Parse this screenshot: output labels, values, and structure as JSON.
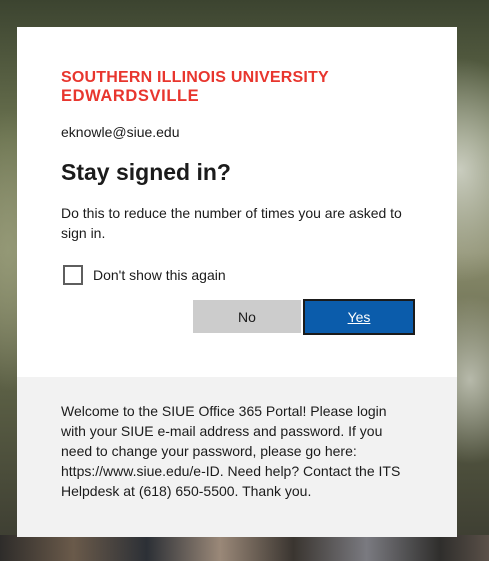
{
  "org": {
    "logo_line1": "SOUTHERN ILLINOIS UNIVERSITY",
    "logo_line2": "EDWARDSVILLE",
    "logo_color": "#e8362e"
  },
  "account": {
    "email": "eknowle@siue.edu"
  },
  "prompt": {
    "title": "Stay signed in?",
    "description": "Do this to reduce the number of times you are asked to sign in.",
    "checkbox_label": "Don't show this again",
    "checkbox_checked": false
  },
  "buttons": {
    "no_label": "No",
    "yes_label": "Yes",
    "primary_color": "#0b5cab"
  },
  "footer": {
    "text": "Welcome to the SIUE Office 365 Portal! Please login with your SIUE e-mail address and password. If you need to change your password, please go here: https://www.siue.edu/e-ID. Need help? Contact the ITS Helpdesk at (618) 650-5500. Thank you."
  }
}
